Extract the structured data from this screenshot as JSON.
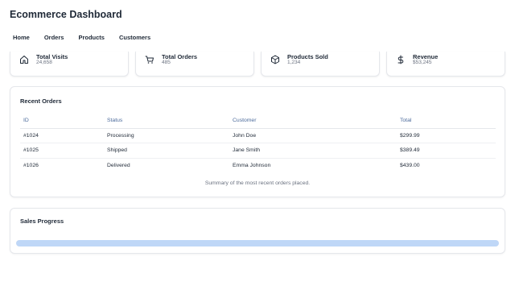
{
  "app": {
    "title": "Ecommerce Dashboard"
  },
  "nav": [
    "Home",
    "Orders",
    "Products",
    "Customers"
  ],
  "stats": [
    {
      "label": "Total Visits",
      "value": "24,658",
      "icon": "home-icon"
    },
    {
      "label": "Total Orders",
      "value": "485",
      "icon": "cart-icon"
    },
    {
      "label": "Products Sold",
      "value": "1,234",
      "icon": "box-icon"
    },
    {
      "label": "Revenue",
      "value": "$53,245",
      "icon": "dollar-icon"
    }
  ],
  "orders": {
    "title": "Recent Orders",
    "columns": [
      "ID",
      "Status",
      "Customer",
      "Total"
    ],
    "rows": [
      [
        "#1024",
        "Processing",
        "John Doe",
        "$299.99"
      ],
      [
        "#1025",
        "Shipped",
        "Jane Smith",
        "$389.49"
      ],
      [
        "#1026",
        "Delivered",
        "Emma Johnson",
        "$439.00"
      ]
    ],
    "caption": "Summary of the most recent orders placed."
  },
  "sales": {
    "title": "Sales Progress",
    "progress": 1.0
  },
  "colors": {
    "progress_fill": "#bfd7f7",
    "header_text": "#4b6a9b"
  }
}
